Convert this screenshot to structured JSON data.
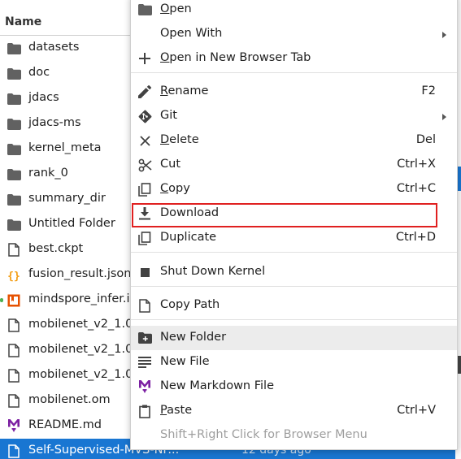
{
  "browser": {
    "column_header": "Name",
    "files": [
      {
        "name": "datasets",
        "icon": "folder-icon"
      },
      {
        "name": "doc",
        "icon": "folder-icon"
      },
      {
        "name": "jdacs",
        "icon": "folder-icon"
      },
      {
        "name": "jdacs-ms",
        "icon": "folder-icon"
      },
      {
        "name": "kernel_meta",
        "icon": "folder-icon"
      },
      {
        "name": "rank_0",
        "icon": "folder-icon"
      },
      {
        "name": "summary_dir",
        "icon": "folder-icon"
      },
      {
        "name": "Untitled Folder",
        "icon": "folder-icon"
      },
      {
        "name": "best.ckpt",
        "icon": "file-icon"
      },
      {
        "name": "fusion_result.json",
        "icon": "json-icon"
      },
      {
        "name": "mindspore_infer.i",
        "icon": "notebook-icon"
      },
      {
        "name": "mobilenet_v2_1.0",
        "icon": "file-icon"
      },
      {
        "name": "mobilenet_v2_1.0",
        "icon": "file-icon"
      },
      {
        "name": "mobilenet_v2_1.0",
        "icon": "file-icon"
      },
      {
        "name": "mobilenet.om",
        "icon": "file-icon"
      },
      {
        "name": "README.md",
        "icon": "markdown-icon"
      },
      {
        "name": "Self-Supervised-MVS-NF...",
        "icon": "file-icon",
        "date": "12 days ago",
        "selected": true
      }
    ]
  },
  "menu": {
    "open": {
      "pre": "",
      "u": "O",
      "post": "pen"
    },
    "open_with": "Open With",
    "open_new_tab": {
      "pre": "",
      "u": "O",
      "post": "pen in New Browser Tab"
    },
    "rename": {
      "pre": "",
      "u": "R",
      "post": "ename"
    },
    "rename_shortcut": "F2",
    "git": "Git",
    "delete": {
      "pre": "",
      "u": "D",
      "post": "elete"
    },
    "delete_shortcut": "Del",
    "cut": "Cut",
    "cut_shortcut": "Ctrl+X",
    "copy": {
      "pre": "",
      "u": "C",
      "post": "opy"
    },
    "copy_shortcut": "Ctrl+C",
    "download": "Download",
    "duplicate": "Duplicate",
    "duplicate_shortcut": "Ctrl+D",
    "shut_down_kernel": "Shut Down Kernel",
    "copy_path": "Copy Path",
    "new_folder": "New Folder",
    "new_file": "New File",
    "new_markdown_file": "New Markdown File",
    "paste": {
      "pre": "",
      "u": "P",
      "post": "aste"
    },
    "paste_shortcut": "Ctrl+V",
    "browser_menu_hint": "Shift+Right Click for Browser Menu"
  },
  "colors": {
    "selection": "#1976d2",
    "highlight_box": "#e02020",
    "folder": "#616161",
    "json": "#f39c12",
    "notebook": "#e65100",
    "markdown": "#7b1fa2"
  }
}
